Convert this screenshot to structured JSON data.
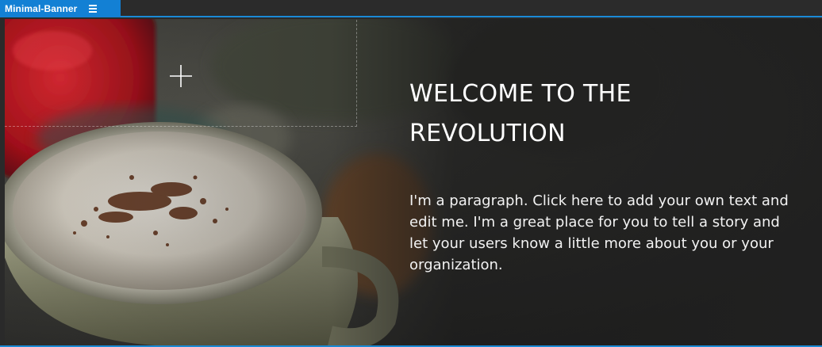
{
  "section_tag": {
    "name": "Minimal-Banner",
    "menu_icon": "hamburger-menu-icon"
  },
  "banner": {
    "heading": "WELCOME TO THE REVOLUTION",
    "paragraph": "I'm a paragraph. Click here to add your own text and edit me. I'm a great place for you to tell a story and let your users know a little more about you or your organization.",
    "add_icon": "plus-icon",
    "background_image": "coffee-cup-photo"
  },
  "colors": {
    "accent": "#1380d4",
    "selection_line": "#1a8ad6",
    "text": "#ffffff",
    "overlay": "#2a2a2a"
  }
}
